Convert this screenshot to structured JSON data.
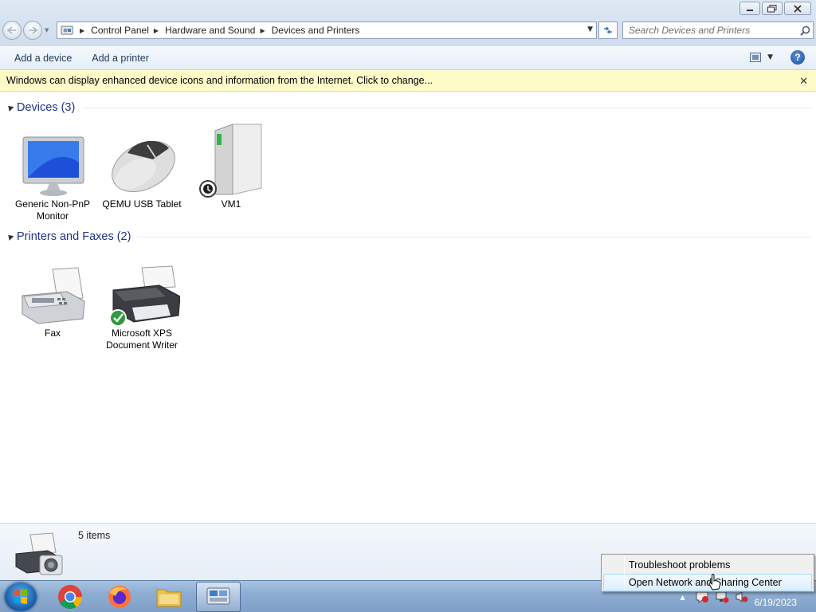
{
  "window": {
    "address": {
      "crumbs": [
        "Control Panel",
        "Hardware and Sound",
        "Devices and Printers"
      ]
    },
    "search": {
      "placeholder": "Search Devices and Printers"
    },
    "commands": {
      "add_device": "Add a device",
      "add_printer": "Add a printer"
    },
    "infobar": {
      "text": "Windows can display enhanced device icons and information from the Internet. Click to change..."
    },
    "groups": {
      "devices": {
        "title": "Devices (3)",
        "items": [
          {
            "label": "Generic Non-PnP Monitor",
            "icon": "monitor-icon"
          },
          {
            "label": "QEMU USB Tablet",
            "icon": "mouse-icon"
          },
          {
            "label": "VM1",
            "icon": "computer-icon"
          }
        ]
      },
      "printers": {
        "title": "Printers and Faxes (2)",
        "items": [
          {
            "label": "Fax",
            "icon": "fax-icon"
          },
          {
            "label": "Microsoft XPS Document Writer",
            "icon": "printer-icon",
            "default": true
          }
        ]
      }
    },
    "details": {
      "count": "5 items"
    }
  },
  "taskbar": {
    "apps": [
      "start",
      "chrome",
      "firefox",
      "explorer",
      "devices-and-printers"
    ],
    "clock": {
      "time": "",
      "date": "6/19/2023"
    }
  },
  "context_menu": {
    "items": [
      "Troubleshoot problems",
      "Open Network and Sharing Center"
    ],
    "hovered_index": 1
  },
  "colors": {
    "group_title": "#1e3287",
    "infobar": "#fefbc9",
    "link": "#1e395b"
  }
}
